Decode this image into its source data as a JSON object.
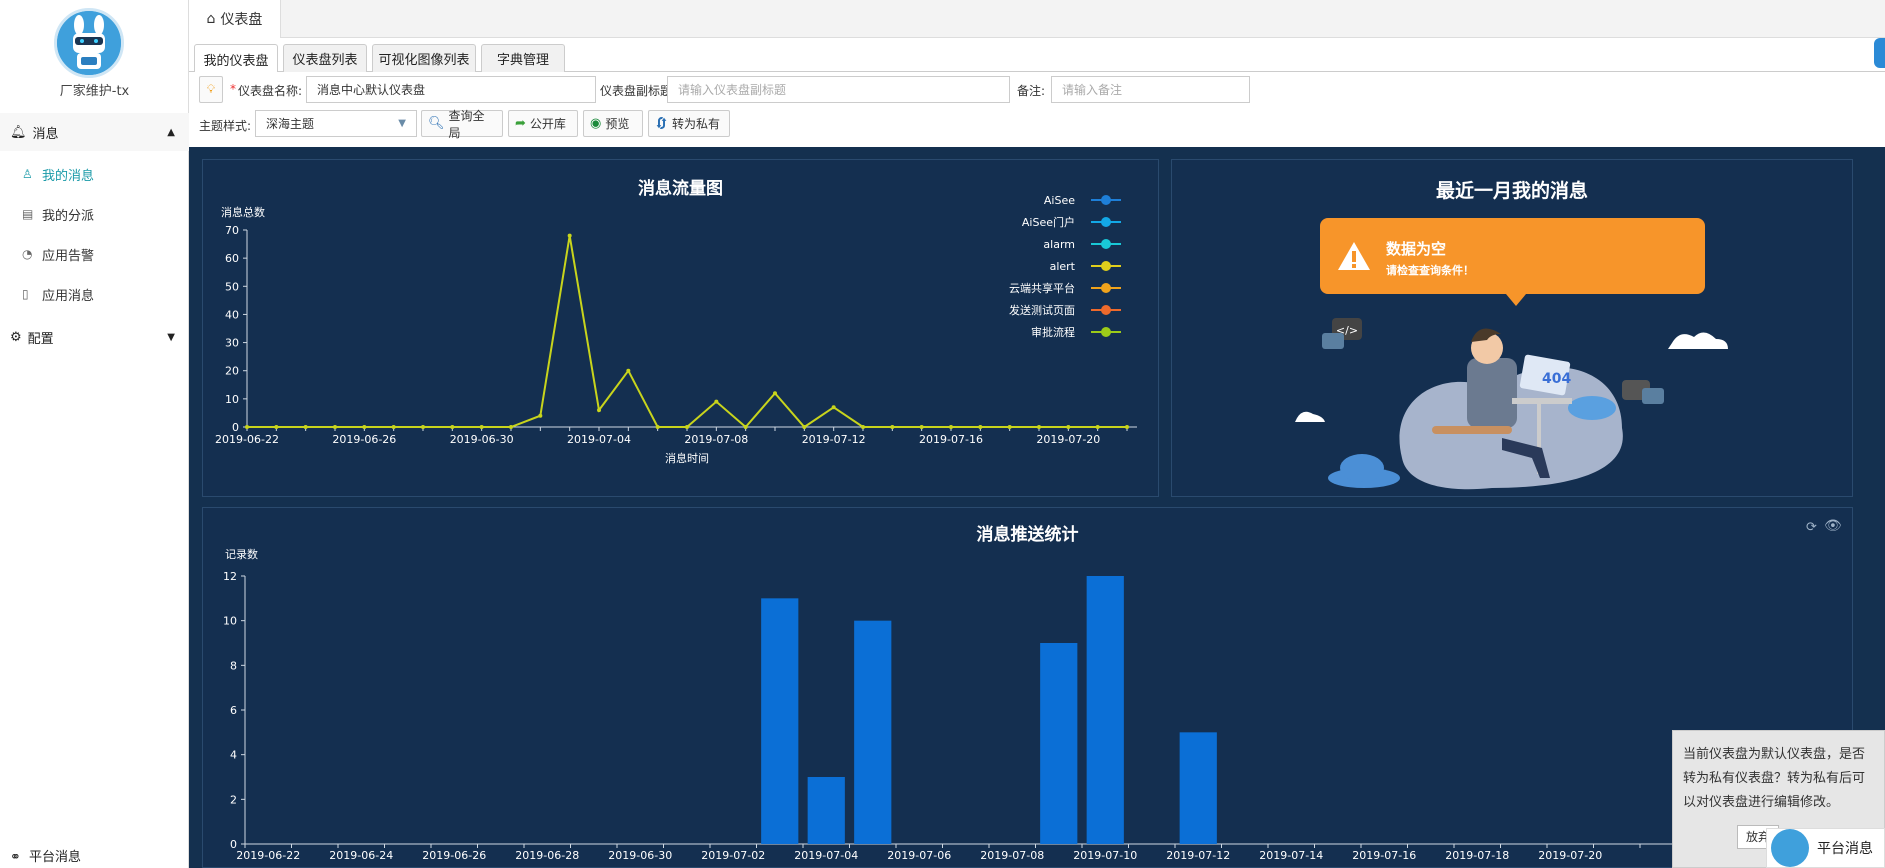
{
  "sidebar": {
    "username": "厂家维护-tx",
    "groups": [
      {
        "label": "消息",
        "arrow": "▲"
      },
      {
        "label": "配置",
        "arrow": "▼"
      }
    ],
    "items": [
      {
        "label": "我的消息",
        "icon": "user-icon"
      },
      {
        "label": "我的分派",
        "icon": "clipboard-icon"
      },
      {
        "label": "应用告警",
        "icon": "gauge-icon"
      },
      {
        "label": "应用消息",
        "icon": "document-icon"
      }
    ],
    "footer": "平台消息"
  },
  "topbar": {
    "home_tab": "仪表盘"
  },
  "subtabs": [
    "我的仪表盘",
    "仪表盘列表",
    "可视化图像列表",
    "字典管理"
  ],
  "form": {
    "name_label": "仪表盘名称:",
    "required_mark": "*",
    "name_value": "消息中心默认仪表盘",
    "subtitle_label": "仪表盘副标题:",
    "subtitle_placeholder": "请输入仪表盘副标题",
    "remark_label": "备注:",
    "remark_placeholder": "请输入备注",
    "theme_label": "主题样式:",
    "theme_value": "深海主题",
    "buttons": [
      "查询全局",
      "公开库",
      "预览",
      "转为私有"
    ]
  },
  "panels": {
    "flow_title": "消息流量图",
    "recent_title": "最近一月我的消息",
    "empty_title": "数据为空",
    "empty_sub": "请检查查询条件！",
    "push_title": "消息推送统计"
  },
  "tip": {
    "text": "当前仪表盘为默认仪表盘，是否转为私有仪表盘？转为私有后可以对仪表盘进行编辑修改。",
    "button": "放弃"
  },
  "float_msg": "平台消息",
  "colors": {
    "dashboard_bg": "#14304f",
    "line": "#c8d41c",
    "bar": "#0b6fd6",
    "bubble": "#f7952a",
    "active": "#1a9aa8"
  },
  "chart_data": [
    {
      "type": "line",
      "title": "消息流量图",
      "ylabel": "消息总数",
      "xlabel": "消息时间",
      "ylim": [
        0,
        70
      ],
      "yticks": [
        0,
        10,
        20,
        30,
        40,
        50,
        60,
        70
      ],
      "xtick_labels": [
        "2019-06-22",
        "2019-06-26",
        "2019-06-30",
        "2019-07-04",
        "2019-07-08",
        "2019-07-12",
        "2019-07-16",
        "2019-07-20"
      ],
      "x": [
        "2019-06-22",
        "2019-06-23",
        "2019-06-24",
        "2019-06-25",
        "2019-06-26",
        "2019-06-27",
        "2019-06-28",
        "2019-06-29",
        "2019-06-30",
        "2019-07-01",
        "2019-07-02",
        "2019-07-03",
        "2019-07-04",
        "2019-07-05",
        "2019-07-06",
        "2019-07-07",
        "2019-07-08",
        "2019-07-09",
        "2019-07-10",
        "2019-07-11",
        "2019-07-12",
        "2019-07-13",
        "2019-07-14",
        "2019-07-15",
        "2019-07-16",
        "2019-07-17",
        "2019-07-18",
        "2019-07-19",
        "2019-07-20",
        "2019-07-21",
        "2019-07-22"
      ],
      "series": [
        {
          "name": "审批流程",
          "values": [
            0,
            0,
            0,
            0,
            0,
            0,
            0,
            0,
            0,
            0,
            4,
            68,
            6,
            20,
            0,
            0,
            9,
            0,
            12,
            0,
            7,
            0,
            0,
            0,
            0,
            0,
            0,
            0,
            0,
            0,
            0
          ]
        }
      ],
      "legend": [
        {
          "name": "AiSee",
          "color": "#1e7fd8"
        },
        {
          "name": "AiSee门户",
          "color": "#13a8e6"
        },
        {
          "name": "alarm",
          "color": "#19c8d6"
        },
        {
          "name": "alert",
          "color": "#e0cf1c"
        },
        {
          "name": "云端共享平台",
          "color": "#f0a31c"
        },
        {
          "name": "发送测试页面",
          "color": "#ee6a2c"
        },
        {
          "name": "审批流程",
          "color": "#9ccb19"
        }
      ],
      "legend_position": "top-right"
    },
    {
      "type": "bar",
      "title": "消息推送统计",
      "ylabel": "记录数",
      "ylim": [
        0,
        12
      ],
      "yticks": [
        0,
        2,
        4,
        6,
        8,
        10,
        12
      ],
      "xtick_labels": [
        "2019-06-22",
        "2019-06-24",
        "2019-06-26",
        "2019-06-28",
        "2019-06-30",
        "2019-07-02",
        "2019-07-04",
        "2019-07-06",
        "2019-07-08",
        "2019-07-10",
        "2019-07-12",
        "2019-07-14",
        "2019-07-16",
        "2019-07-18",
        "2019-07-20"
      ],
      "categories": [
        "2019-06-22",
        "2019-06-23",
        "2019-06-24",
        "2019-06-25",
        "2019-06-26",
        "2019-06-27",
        "2019-06-28",
        "2019-06-29",
        "2019-06-30",
        "2019-07-01",
        "2019-07-02",
        "2019-07-03",
        "2019-07-04",
        "2019-07-05",
        "2019-07-06",
        "2019-07-07",
        "2019-07-08",
        "2019-07-09",
        "2019-07-10",
        "2019-07-11",
        "2019-07-12",
        "2019-07-13",
        "2019-07-14",
        "2019-07-15",
        "2019-07-16",
        "2019-07-17",
        "2019-07-18",
        "2019-07-19",
        "2019-07-20",
        "2019-07-21",
        "2019-07-22",
        "2019-07-23"
      ],
      "values": [
        0,
        0,
        0,
        0,
        0,
        0,
        0,
        0,
        0,
        0,
        0,
        11,
        3,
        10,
        0,
        0,
        0,
        9,
        12,
        0,
        5,
        0,
        0,
        0,
        0,
        0,
        0,
        0,
        0,
        0,
        0,
        0
      ]
    }
  ]
}
